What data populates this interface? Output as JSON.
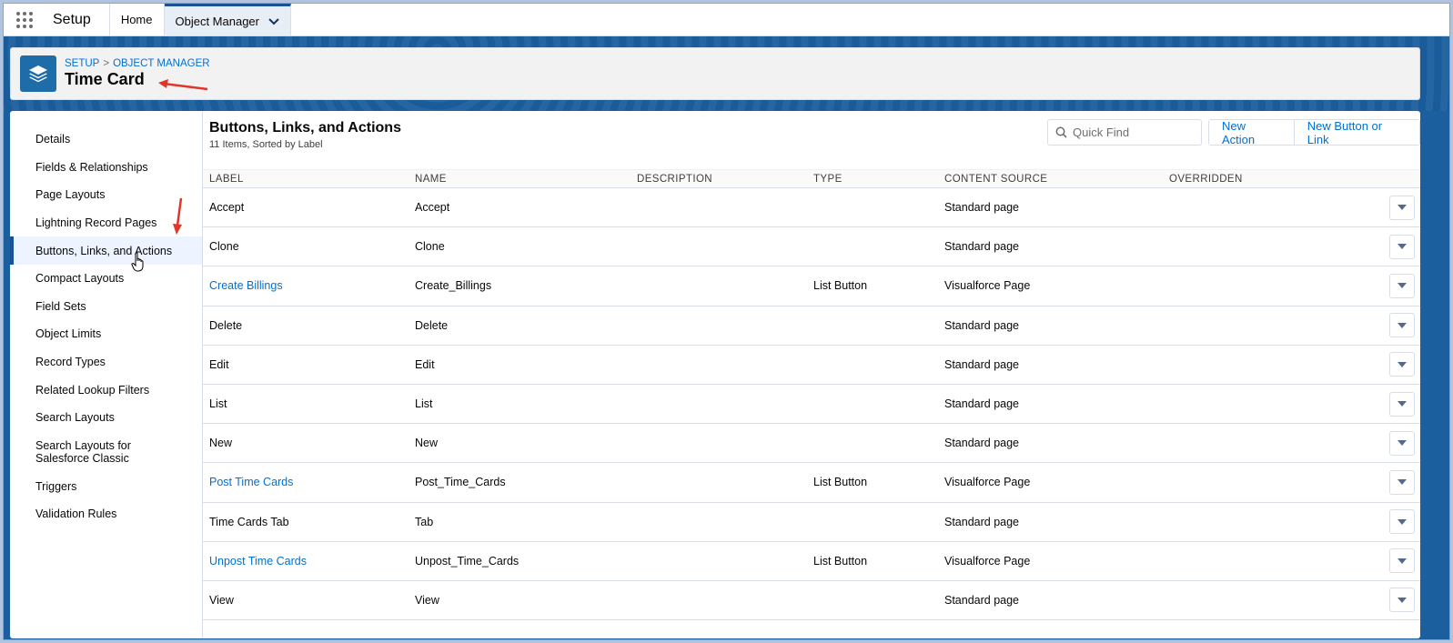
{
  "app": {
    "name": "Setup"
  },
  "nav_tabs": [
    {
      "label": "Home"
    },
    {
      "label": "Object Manager"
    }
  ],
  "header": {
    "breadcrumb": [
      "SETUP",
      "OBJECT MANAGER"
    ],
    "breadcrumb_separator": ">",
    "title": "Time Card"
  },
  "sidebar": {
    "items": [
      {
        "label": "Details"
      },
      {
        "label": "Fields & Relationships"
      },
      {
        "label": "Page Layouts"
      },
      {
        "label": "Lightning Record Pages"
      },
      {
        "label": "Buttons, Links, and Actions",
        "active": true
      },
      {
        "label": "Compact Layouts"
      },
      {
        "label": "Field Sets"
      },
      {
        "label": "Object Limits"
      },
      {
        "label": "Record Types"
      },
      {
        "label": "Related Lookup Filters"
      },
      {
        "label": "Search Layouts"
      },
      {
        "label": "Search Layouts for Salesforce Classic"
      },
      {
        "label": "Triggers"
      },
      {
        "label": "Validation Rules"
      }
    ]
  },
  "section": {
    "title": "Buttons, Links, and Actions",
    "subtitle": "11 Items, Sorted by Label",
    "quick_find_placeholder": "Quick Find",
    "new_action_label": "New Action",
    "new_button_label": "New Button or Link"
  },
  "table": {
    "columns": [
      "LABEL",
      "NAME",
      "DESCRIPTION",
      "TYPE",
      "CONTENT SOURCE",
      "OVERRIDDEN"
    ],
    "rows": [
      {
        "label": "Accept",
        "name": "Accept",
        "description": "",
        "type": "",
        "source": "Standard page",
        "overridden": "",
        "link": false
      },
      {
        "label": "Clone",
        "name": "Clone",
        "description": "",
        "type": "",
        "source": "Standard page",
        "overridden": "",
        "link": false
      },
      {
        "label": "Create Billings",
        "name": "Create_Billings",
        "description": "",
        "type": "List Button",
        "source": "Visualforce Page",
        "overridden": "",
        "link": true
      },
      {
        "label": "Delete",
        "name": "Delete",
        "description": "",
        "type": "",
        "source": "Standard page",
        "overridden": "",
        "link": false
      },
      {
        "label": "Edit",
        "name": "Edit",
        "description": "",
        "type": "",
        "source": "Standard page",
        "overridden": "",
        "link": false
      },
      {
        "label": "List",
        "name": "List",
        "description": "",
        "type": "",
        "source": "Standard page",
        "overridden": "",
        "link": false
      },
      {
        "label": "New",
        "name": "New",
        "description": "",
        "type": "",
        "source": "Standard page",
        "overridden": "",
        "link": false
      },
      {
        "label": "Post Time Cards",
        "name": "Post_Time_Cards",
        "description": "",
        "type": "List Button",
        "source": "Visualforce Page",
        "overridden": "",
        "link": true
      },
      {
        "label": "Time Cards Tab",
        "name": "Tab",
        "description": "",
        "type": "",
        "source": "Standard page",
        "overridden": "",
        "link": false
      },
      {
        "label": "Unpost Time Cards",
        "name": "Unpost_Time_Cards",
        "description": "",
        "type": "List Button",
        "source": "Visualforce Page",
        "overridden": "",
        "link": true
      },
      {
        "label": "View",
        "name": "View",
        "description": "",
        "type": "",
        "source": "Standard page",
        "overridden": "",
        "link": false
      }
    ]
  },
  "colors": {
    "brand_blue": "#1b5f9e",
    "link_blue": "#0070d2",
    "annotation_red": "#e0352b",
    "object_icon": "#1f6da8"
  },
  "icons": {
    "app_launcher": "waffle-icon",
    "tab_menu": "chevron-down-icon",
    "object": "layers-icon",
    "search": "search-icon",
    "row_menu": "caret-down-icon"
  }
}
